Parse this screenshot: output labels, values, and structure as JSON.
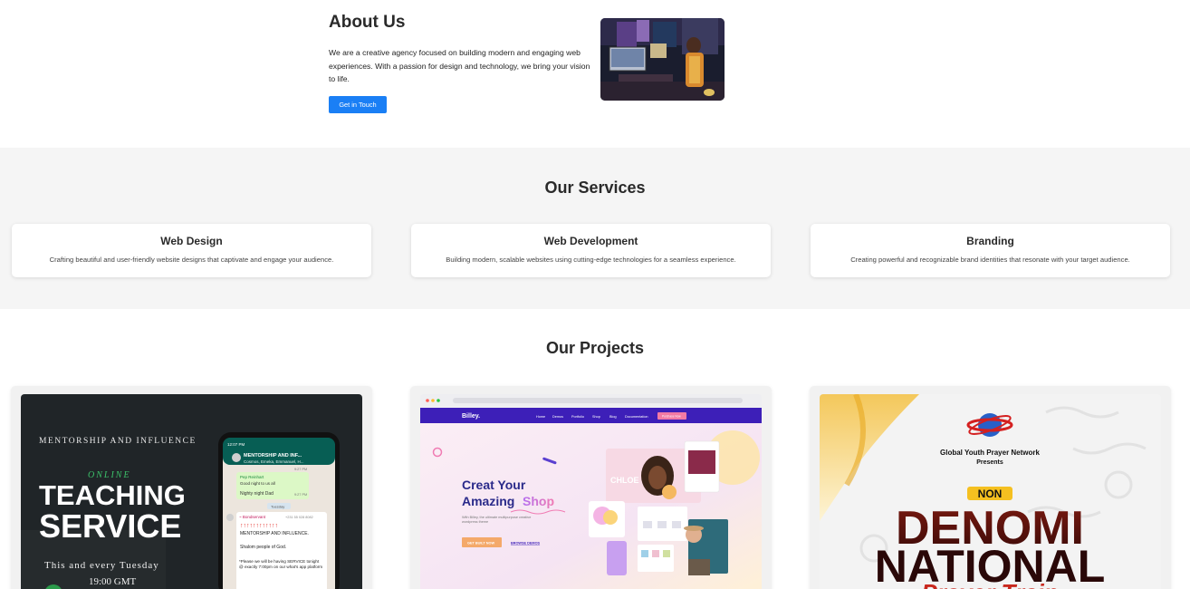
{
  "about": {
    "title": "About Us",
    "body": "We are a creative agency focused on building modern and engaging web experiences. With a passion for design and technology, we bring your vision to life.",
    "button_label": "Get in Touch"
  },
  "services": {
    "title": "Our Services",
    "items": [
      {
        "title": "Web Design",
        "desc": "Crafting beautiful and user-friendly website designs that captivate and engage your audience."
      },
      {
        "title": "Web Development",
        "desc": "Building modern, scalable websites using cutting-edge technologies for a seamless experience."
      },
      {
        "title": "Branding",
        "desc": "Creating powerful and recognizable brand identities that resonate with your target audience."
      }
    ]
  },
  "projects": {
    "title": "Our Projects",
    "teaching": {
      "header": "MENTORSHIP AND INFLUENCE",
      "online": "ONLINE",
      "line1": "TEACHING",
      "line2": "SERVICE",
      "schedule": "This and every Tuesday",
      "time": "19:00 GMT",
      "phone_status_time": "12:07 PM",
      "chat_name": "MENTORSHIP AND INF...",
      "chat_members": "Cosmos, Emeka, Emmanuel, H...",
      "chat_author": "Pep Reinhart",
      "chat_msg1": "Good night to us all",
      "chat_msg2": "Nighty night Dad",
      "chat_time1": "9:27 PM",
      "chat_time2": "9:27 PM",
      "day_label": "Tuesday",
      "sender": "~ Bondservant",
      "sender_phone": "+231 55 028 8082",
      "announce1": "MENTORSHIP AND INFLUENCE.",
      "announce2": "Shalom people of God.",
      "announce3": "*Please we will be having SERVICE tonight @ exactly 7:00pm on our what's app platform"
    },
    "billey": {
      "brand": "Billey.",
      "nav": [
        "Home",
        "Demos",
        "Portfolio",
        "Shop",
        "Blog",
        "Documentation"
      ],
      "nav_cta": "Purchase Now",
      "headline1": "Creat Your",
      "headline2a": "Amazing",
      "headline2b": "Shop",
      "sub": "With Billey, the ultimate multipurpose creative wordpress theme",
      "cta1": "GET BUILT NOW",
      "cta2": "BROWSE DEMOS",
      "mock_name": "CHLOE"
    },
    "prayer": {
      "org": "Global Youth Prayer Network",
      "presents": "Presents",
      "badge": "NON",
      "line1": "DENOMI",
      "line2": "NATIONAL",
      "line3": "Prayer Train"
    }
  },
  "colors": {
    "accent": "#1a7ff5",
    "section_bg": "#f5f5f5",
    "billey_purple": "#3d1fb8",
    "prayer_red": "#c8281e"
  }
}
